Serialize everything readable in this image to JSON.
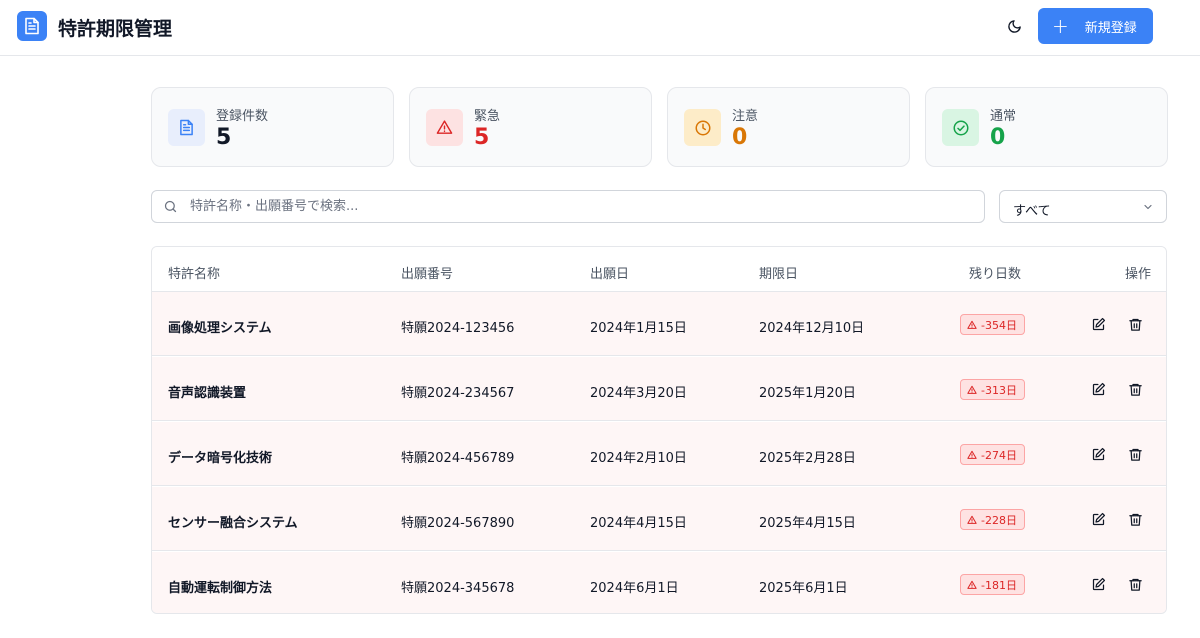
{
  "header": {
    "title": "特許期限管理",
    "new_button_label": "新規登録"
  },
  "stats": [
    {
      "label": "登録件数",
      "value": "5",
      "color": "#111827",
      "icon": "document-icon",
      "icon_bg": "#e8eefc",
      "icon_color": "#3b82f6"
    },
    {
      "label": "緊急",
      "value": "5",
      "color": "#dc2626",
      "icon": "alert-triangle-icon",
      "icon_bg": "#fde2e2",
      "icon_color": "#dc2626"
    },
    {
      "label": "注意",
      "value": "0",
      "color": "#d97706",
      "icon": "clock-icon",
      "icon_bg": "#fdecc8",
      "icon_color": "#d97706"
    },
    {
      "label": "通常",
      "value": "0",
      "color": "#16a34a",
      "icon": "check-circle-icon",
      "icon_bg": "#d9f5e3",
      "icon_color": "#16a34a"
    }
  ],
  "search": {
    "placeholder": "特許名称・出願番号で検索..."
  },
  "filter": {
    "selected": "すべて"
  },
  "table": {
    "headers": [
      "特許名称",
      "出願番号",
      "出願日",
      "期限日",
      "残り日数",
      "操作"
    ],
    "rows": [
      {
        "name": "画像処理システム",
        "number": "特願2024-123456",
        "filed": "2024年1月15日",
        "deadline": "2024年12月10日",
        "remaining": "-354日"
      },
      {
        "name": "音声認識装置",
        "number": "特願2024-234567",
        "filed": "2024年3月20日",
        "deadline": "2025年1月20日",
        "remaining": "-313日"
      },
      {
        "name": "データ暗号化技術",
        "number": "特願2024-456789",
        "filed": "2024年2月10日",
        "deadline": "2025年2月28日",
        "remaining": "-274日"
      },
      {
        "name": "センサー融合システム",
        "number": "特願2024-567890",
        "filed": "2024年4月15日",
        "deadline": "2025年4月15日",
        "remaining": "-228日"
      },
      {
        "name": "自動運転制御方法",
        "number": "特願2024-345678",
        "filed": "2024年6月1日",
        "deadline": "2025年6月1日",
        "remaining": "-181日"
      }
    ]
  }
}
